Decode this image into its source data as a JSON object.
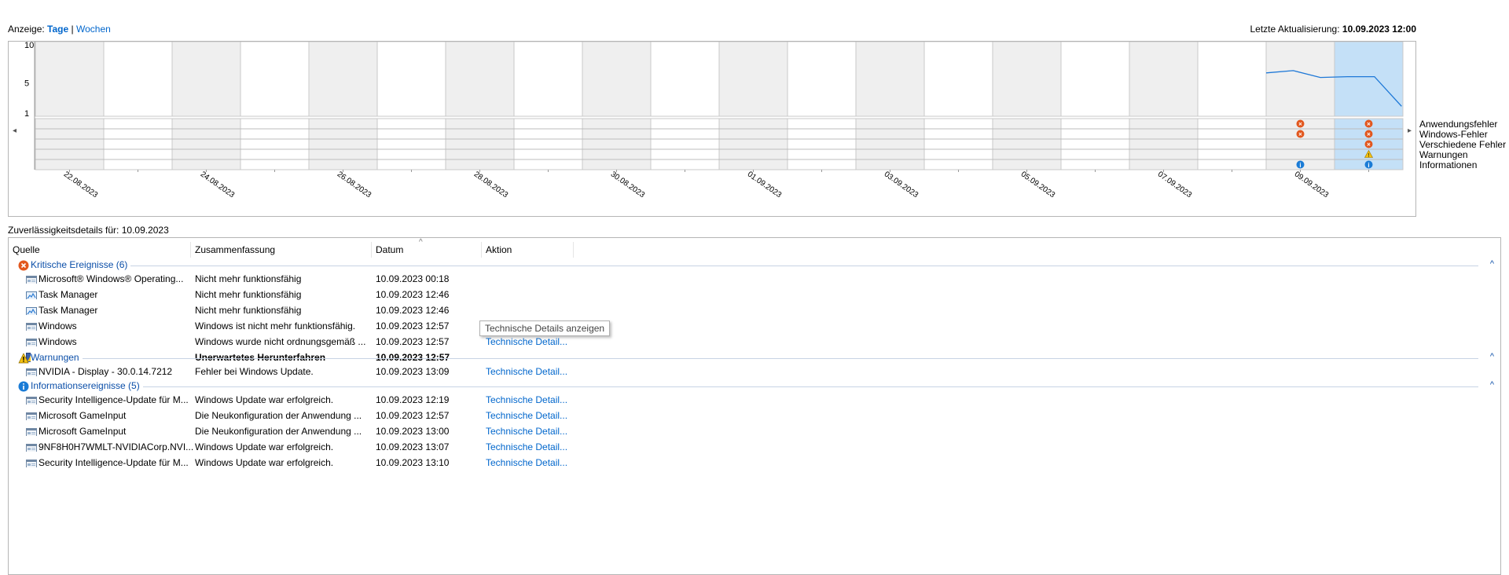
{
  "view": {
    "label": "Anzeige:",
    "days": "Tage",
    "separator": "|",
    "weeks": "Wochen"
  },
  "last_update": {
    "label": "Letzte Aktualisierung:",
    "value": "10.09.2023 12:00"
  },
  "chart": {
    "y_ticks": [
      "10",
      "5",
      "1"
    ],
    "dates": [
      "22.08.2023",
      "24.08.2023",
      "26.08.2023",
      "28.08.2023",
      "30.08.2023",
      "01.09.2023",
      "03.09.2023",
      "05.09.2023",
      "07.09.2023",
      "09.09.2023"
    ],
    "index_values": [
      6.3,
      6.6,
      5.7,
      5.8,
      5.8,
      1.9
    ],
    "legend": [
      "Anwendungsfehler",
      "Windows-Fehler",
      "Verschiedene Fehler",
      "Warnungen",
      "Informationen"
    ],
    "selected_day": "10.09.2023",
    "events": {
      "09.09.2023": [
        "error",
        "error",
        "",
        "",
        "info"
      ],
      "10.09.2023": [
        "error",
        "error",
        "error",
        "warning",
        "info"
      ]
    },
    "colors": {
      "selected": "#c4e0f7",
      "shaded": "#efefef",
      "line": "#1e78d7",
      "error": "#e2571e",
      "warning": "#f5c211",
      "info": "#1b7cd6"
    }
  },
  "details": {
    "title": "Zuverlässigkeitsdetails für: 10.09.2023",
    "columns": [
      "Quelle",
      "Zusammenfassung",
      "Datum",
      "Aktion"
    ],
    "sort_indicator": "^",
    "collapse_glyph": "^",
    "groups": [
      {
        "title": "Kritische Ereignisse (6)",
        "icon": "error-icon",
        "rows": [
          {
            "icon": "app-icon",
            "source": "Microsoft® Windows® Operating...",
            "summary": "Nicht mehr funktionsfähig",
            "date": "10.09.2023 00:18",
            "action": ""
          },
          {
            "icon": "taskmgr-icon",
            "source": "Task Manager",
            "summary": "Nicht mehr funktionsfähig",
            "date": "10.09.2023 12:46",
            "action": ""
          },
          {
            "icon": "taskmgr-icon",
            "source": "Task Manager",
            "summary": "Nicht mehr funktionsfähig",
            "date": "10.09.2023 12:46",
            "action": ""
          },
          {
            "icon": "app-icon",
            "source": "Windows",
            "summary": "Windows ist nicht mehr funktionsfähig.",
            "date": "10.09.2023 12:57",
            "action": ""
          },
          {
            "icon": "app-icon",
            "source": "Windows",
            "summary": "Windows wurde nicht ordnungsgemäß ...",
            "date": "10.09.2023 12:57",
            "action": "Technische Detail..."
          },
          {
            "icon": "shutdown-icon",
            "source": "Windows",
            "summary": "Unerwartetes Herunterfahren",
            "date": "10.09.2023 12:57",
            "action": "",
            "bold": true
          }
        ]
      },
      {
        "title": "Warnungen",
        "icon": "warning-icon",
        "rows": [
          {
            "icon": "app-icon",
            "source": "NVIDIA - Display - 30.0.14.7212",
            "summary": "Fehler bei Windows Update.",
            "date": "10.09.2023 13:09",
            "action": "Technische Detail..."
          }
        ]
      },
      {
        "title": "Informationsereignisse (5)",
        "icon": "info-icon",
        "rows": [
          {
            "icon": "app-icon",
            "source": "Security Intelligence-Update für M...",
            "summary": "Windows Update war erfolgreich.",
            "date": "10.09.2023 12:19",
            "action": "Technische Detail..."
          },
          {
            "icon": "app-icon",
            "source": "Microsoft GameInput",
            "summary": "Die Neukonfiguration der Anwendung ...",
            "date": "10.09.2023 12:57",
            "action": "Technische Detail..."
          },
          {
            "icon": "app-icon",
            "source": "Microsoft GameInput",
            "summary": "Die Neukonfiguration der Anwendung ...",
            "date": "10.09.2023 13:00",
            "action": "Technische Detail..."
          },
          {
            "icon": "app-icon",
            "source": "9NF8H0H7WMLT-NVIDIACorp.NVI...",
            "summary": "Windows Update war erfolgreich.",
            "date": "10.09.2023 13:07",
            "action": "Technische Detail..."
          },
          {
            "icon": "app-icon",
            "source": "Security Intelligence-Update für M...",
            "summary": "Windows Update war erfolgreich.",
            "date": "10.09.2023 13:10",
            "action": "Technische Detail..."
          }
        ]
      }
    ],
    "tooltip": "Technische Details anzeigen"
  }
}
